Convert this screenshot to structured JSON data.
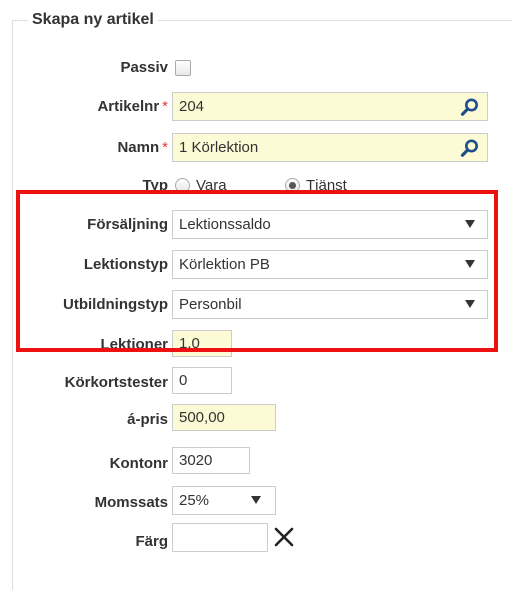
{
  "form": {
    "legend": "Skapa ny artikel",
    "passiv": {
      "label": "Passiv",
      "checked": false
    },
    "artikelnr": {
      "label": "Artikelnr",
      "required_mark": "*",
      "value": "204"
    },
    "namn": {
      "label": "Namn",
      "required_mark": "*",
      "value": "1 Körlektion"
    },
    "typ": {
      "label": "Typ",
      "options": [
        {
          "label": "Vara",
          "checked": false
        },
        {
          "label": "Tjänst",
          "checked": true
        }
      ]
    },
    "forsaljning": {
      "label": "Försäljning",
      "value": "Lektionssaldo"
    },
    "lektionstyp": {
      "label": "Lektionstyp",
      "value": "Körlektion PB"
    },
    "utbildningstyp": {
      "label": "Utbildningstyp",
      "value": "Personbil"
    },
    "lektioner": {
      "label": "Lektioner",
      "value": "1,0"
    },
    "korkortstester": {
      "label": "Körkortstester",
      "value": "0"
    },
    "apris": {
      "label": "á-pris",
      "value": "500,00"
    },
    "kontonr": {
      "label": "Kontonr",
      "value": "3020"
    },
    "momssats": {
      "label": "Momssats",
      "value": "25%"
    },
    "farg": {
      "label": "Färg",
      "value": ""
    }
  },
  "colors": {
    "highlight_border": "#ee1111",
    "required": "#ee3333",
    "input_yellow": "#fdfbd6",
    "search_icon": "#1e4f8c"
  },
  "icons": {
    "search": "search-icon",
    "clear": "close-icon",
    "dropdown": "chevron-down-icon"
  }
}
